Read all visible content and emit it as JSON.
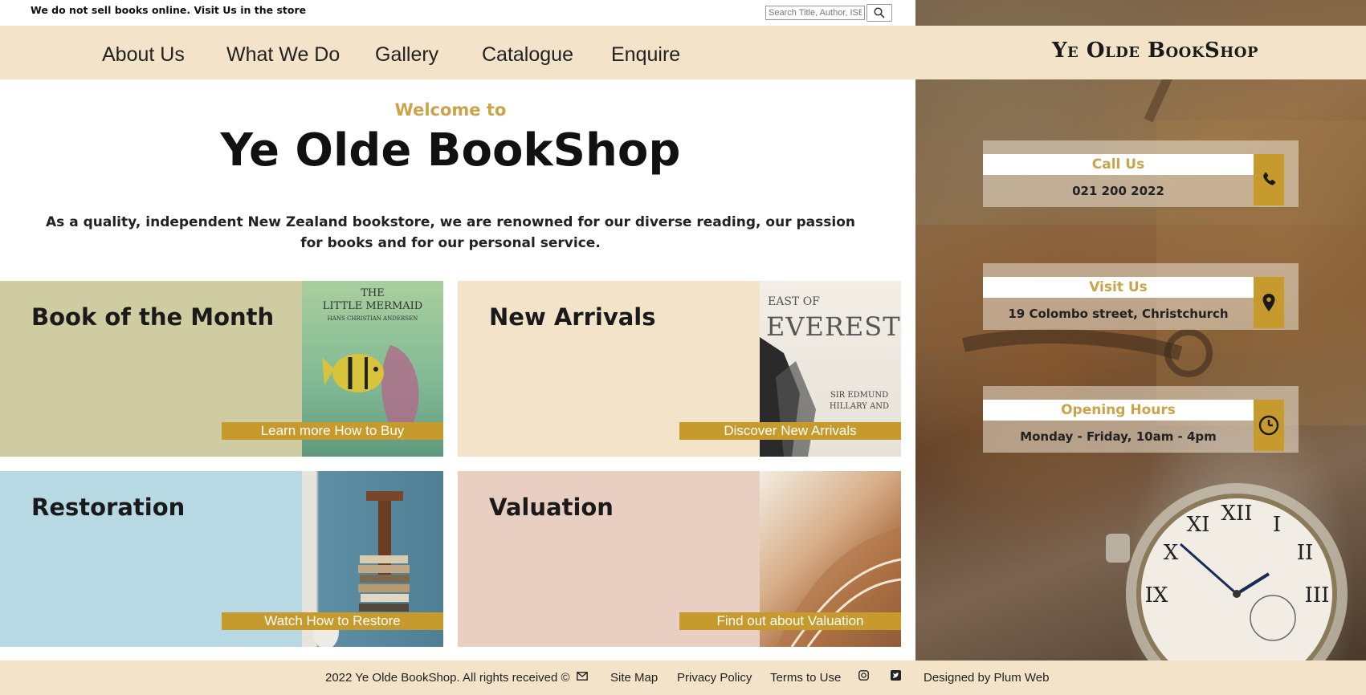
{
  "top_notice": "We do not sell books online. Visit Us in the store",
  "search": {
    "placeholder": "Search Title, Author, ISBN"
  },
  "nav": {
    "items": [
      {
        "label": "About Us"
      },
      {
        "label": "What We Do"
      },
      {
        "label": "Gallery"
      },
      {
        "label": "Catalogue"
      },
      {
        "label": "Enquire"
      }
    ]
  },
  "logo": "Ye Olde BookShop",
  "hero": {
    "welcome": "Welcome to",
    "title": "Ye Olde BookShop",
    "intro": "As a quality, independent New Zealand bookstore, we are renowned for our diverse reading, our passion for books and for our personal service."
  },
  "tiles": [
    {
      "title": "Book of the Month",
      "button": "Learn more How to Buy",
      "bg": "#cfcca2",
      "image_text": {
        "line1": "THE",
        "line2": "LITTLE MERMAID",
        "line3": "HANS CHRISTIAN ANDERSEN"
      }
    },
    {
      "title": "New Arrivals",
      "button": "Discover New Arrivals",
      "bg": "#f3e3c8",
      "image_text": {
        "line1": "EAST OF",
        "line2": "EVEREST",
        "line3": "SIR EDMUND HILLARY AND"
      }
    },
    {
      "title": "Restoration",
      "button": "Watch How to Restore",
      "bg": "#b6d9e4"
    },
    {
      "title": "Valuation",
      "button": "Find out about Valuation",
      "bg": "#e8cfc2"
    }
  ],
  "info_cards": [
    {
      "title": "Call Us",
      "text": "021 200 2022",
      "icon": "phone-icon"
    },
    {
      "title": "Visit Us",
      "text": "19 Colombo street, Christchurch",
      "icon": "map-pin-icon"
    },
    {
      "title": "Opening Hours",
      "text": "Monday - Friday, 10am - 4pm",
      "icon": "clock-icon"
    }
  ],
  "footer": {
    "copyright": "2022 Ye Olde BookShop. All rights received ©",
    "sitemap": "Site Map",
    "privacy": "Privacy Policy",
    "terms": "Terms to Use",
    "designed": "Designed by Plum Web"
  },
  "colors": {
    "accent": "#c69a2c",
    "nav_bg": "#f3e3c8",
    "gold_text": "#c9a44a"
  }
}
